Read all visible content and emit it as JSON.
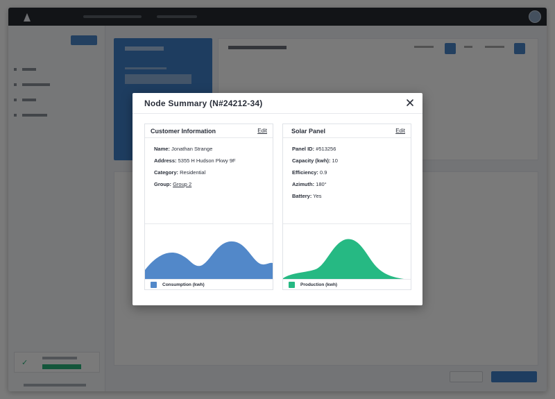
{
  "colors": {
    "accent": "#3f7fc8",
    "consumption": "#5288c9",
    "production": "#26b983",
    "overlay": "#000000"
  },
  "background": {
    "icons": [
      "logo-icon",
      "avatar-icon",
      "check-icon"
    ]
  },
  "modal": {
    "title": "Node Summary (N#24212-34)",
    "close_icon": "close-icon",
    "customer": {
      "title": "Customer Information",
      "edit_label": "Edit",
      "fields": [
        {
          "label": "Name:",
          "value": "Jonathan Strange"
        },
        {
          "label": "Address:",
          "value": "5355 H Hudson Pkwy 9F"
        },
        {
          "label": "Category:",
          "value": "Residential"
        },
        {
          "label": "Group:",
          "value": "Group 2"
        }
      ],
      "legend_label": "Consumption (kwh)"
    },
    "solar": {
      "title": "Solar Panel",
      "edit_label": "Edit",
      "fields": [
        {
          "label": "Panel ID:",
          "value": "#513256"
        },
        {
          "label": "Capacity (kwh):",
          "value": "10"
        },
        {
          "label": "Efficiency:",
          "value": "0.9"
        },
        {
          "label": "Azimuth:",
          "value": "180°"
        },
        {
          "label": "Battery:",
          "value": "Yes"
        }
      ],
      "legend_label": "Production (kwh)"
    }
  }
}
